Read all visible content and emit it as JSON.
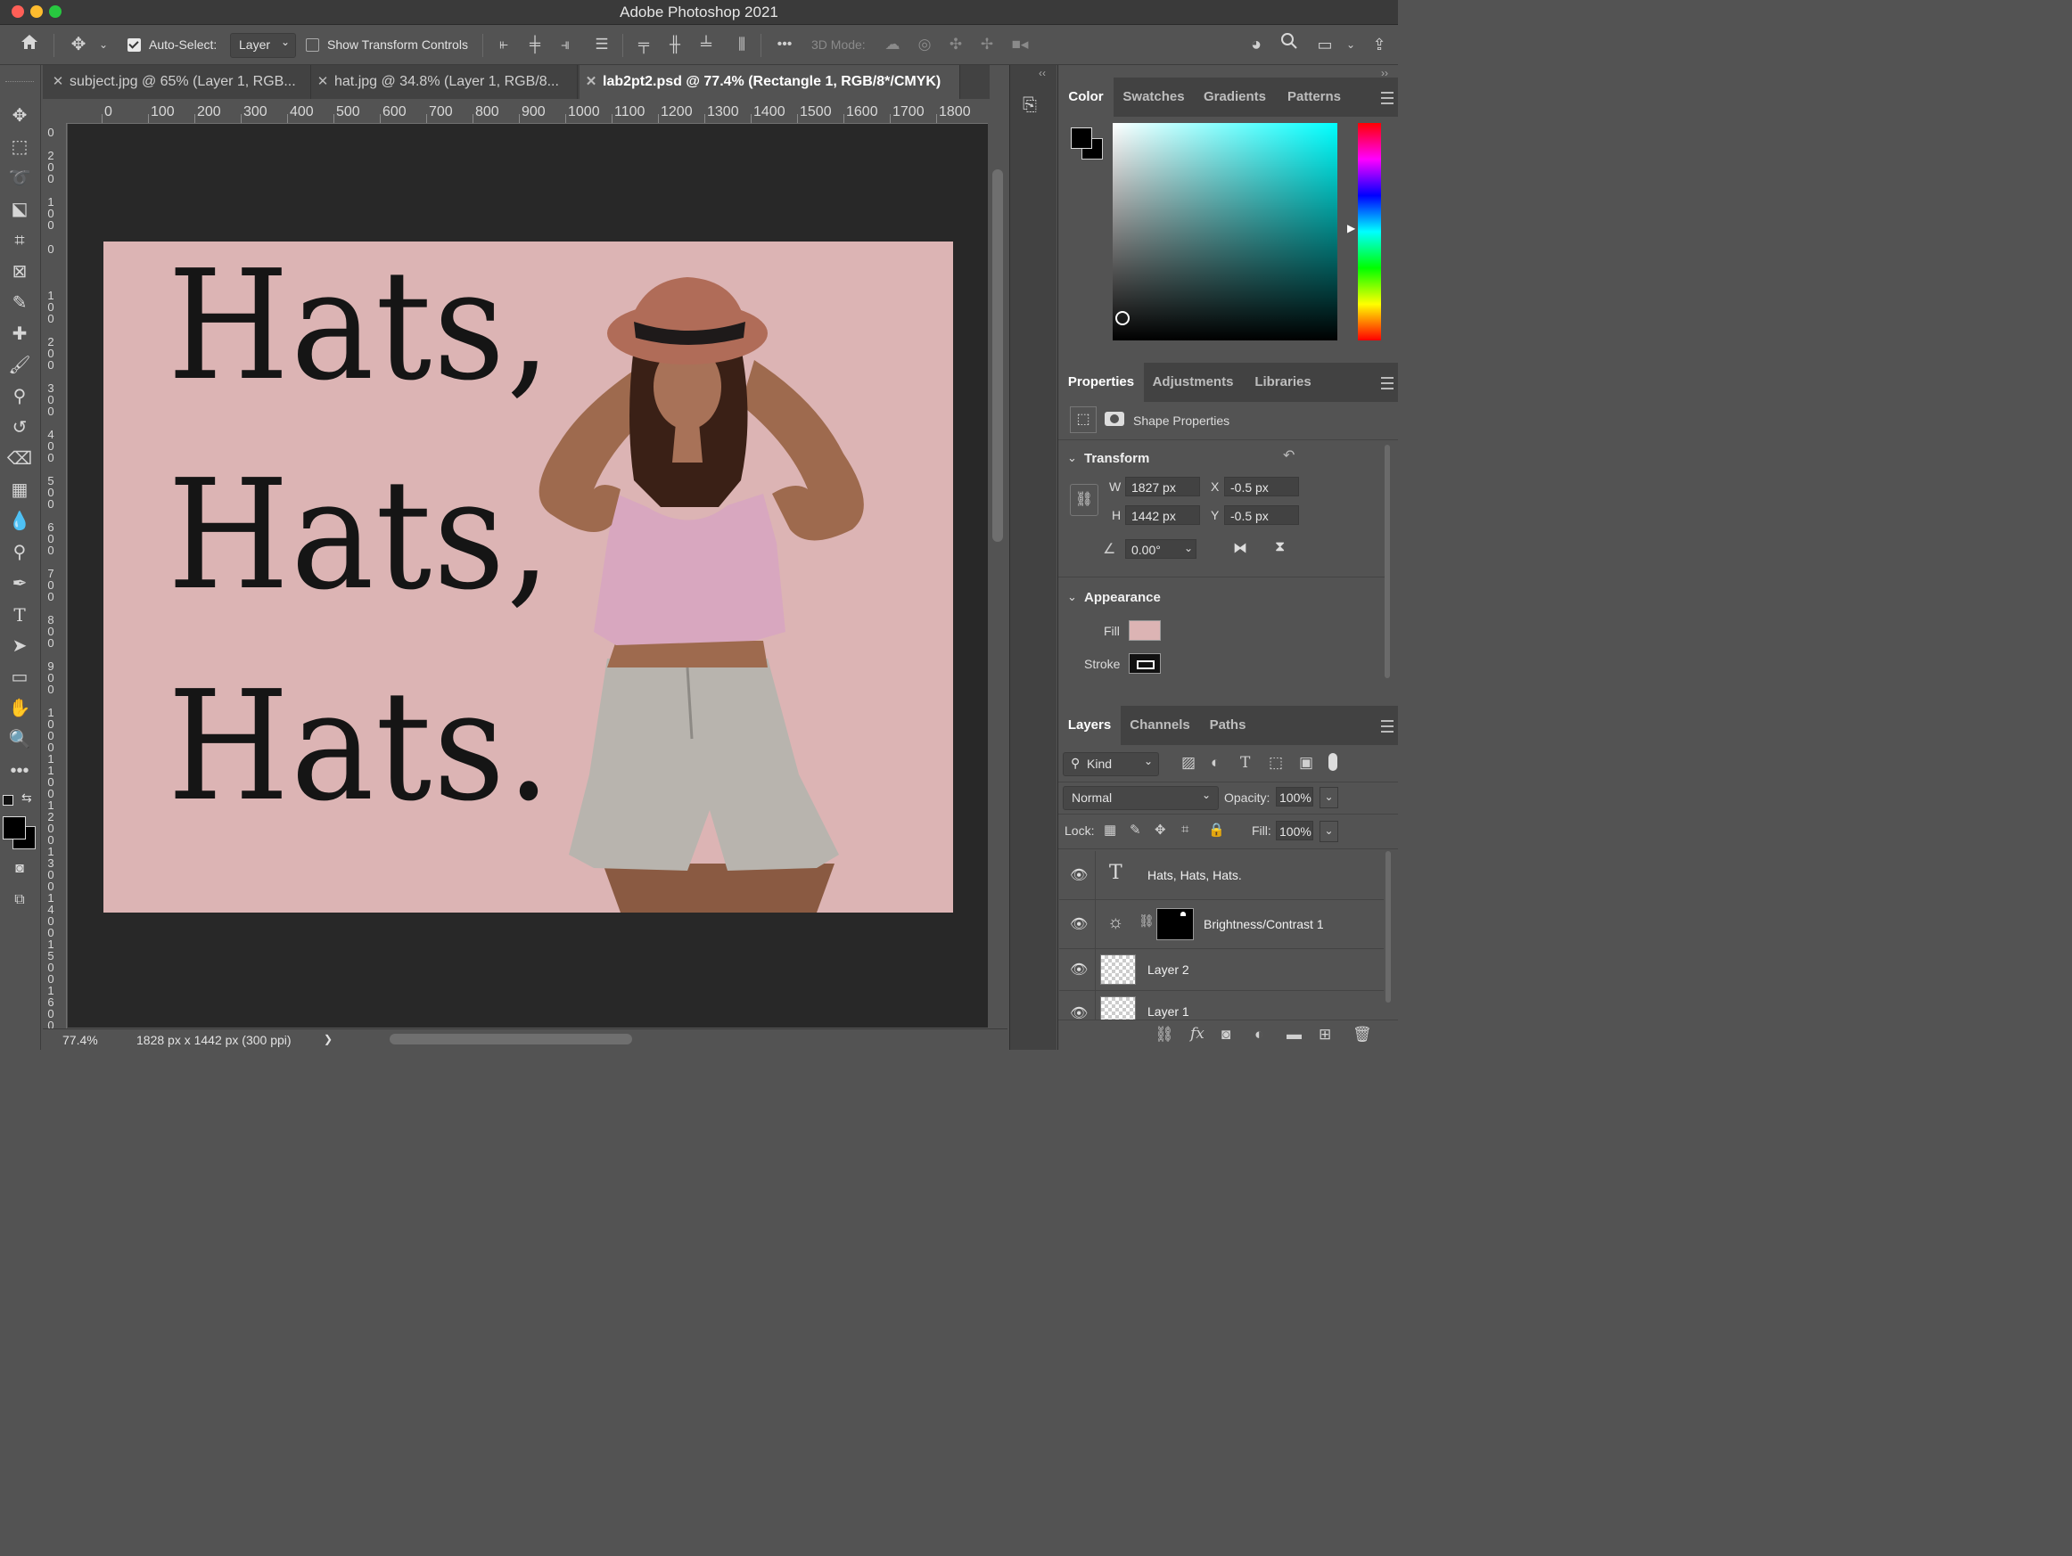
{
  "app": {
    "title": "Adobe Photoshop 2021"
  },
  "options_bar": {
    "auto_select_label": "Auto-Select:",
    "auto_select_value": "Layer",
    "show_transform_label": "Show Transform Controls",
    "three_d_mode_label": "3D Mode:",
    "more_label": "•••"
  },
  "tabs": [
    {
      "label": "subject.jpg @ 65% (Layer 1, RGB..."
    },
    {
      "label": "hat.jpg @ 34.8% (Layer 1, RGB/8..."
    },
    {
      "label": "lab2pt2.psd @ 77.4% (Rectangle 1, RGB/8*/CMYK)"
    }
  ],
  "ruler": {
    "h_labels": [
      "0",
      "100",
      "200",
      "300",
      "400",
      "500",
      "600",
      "700",
      "800",
      "900",
      "1000",
      "1100",
      "1200",
      "1300",
      "1400",
      "1500",
      "1600",
      "1700",
      "1800"
    ],
    "v_labels": [
      "0",
      "2 0 0",
      "1 0 0",
      "0",
      "1 0 0",
      "2 0 0",
      "3 0 0",
      "4 0 0",
      "5 0 0",
      "6 0 0",
      "7 0 0",
      "8 0 0",
      "9 0 0",
      "1 0 0 0",
      "1 1 0 0",
      "1 2 0 0",
      "1 3 0 0",
      "1 4 0 0",
      "1 5 0 0",
      "1 6 0 0"
    ]
  },
  "canvas": {
    "artboard_color": "#dcb4b4",
    "text_lines": [
      "Hats,",
      "Hats,",
      "Hats."
    ]
  },
  "status": {
    "zoom": "77.4%",
    "doc_info": "1828 px x 1442 px (300 ppi)",
    "arrow": "❯"
  },
  "color_panel": {
    "tabs": [
      "Color",
      "Swatches",
      "Gradients",
      "Patterns"
    ],
    "fg_color": "#000000",
    "bg_color": "#000000",
    "hue_color": "#00ffff"
  },
  "properties_panel": {
    "tabs": [
      "Properties",
      "Adjustments",
      "Libraries"
    ],
    "shape_properties_label": "Shape Properties",
    "transform_label": "Transform",
    "w_label": "W",
    "w_value": "1827 px",
    "h_label": "H",
    "h_value": "1442 px",
    "x_label": "X",
    "x_value": "-0.5 px",
    "y_label": "Y",
    "y_value": "-0.5 px",
    "angle_value": "0.00°",
    "appearance_label": "Appearance",
    "fill_label": "Fill",
    "fill_color": "#dcb4b4",
    "stroke_label": "Stroke"
  },
  "layers_panel": {
    "tabs": [
      "Layers",
      "Channels",
      "Paths"
    ],
    "kind_label": "Kind",
    "blend_mode": "Normal",
    "opacity_label": "Opacity:",
    "opacity_value": "100%",
    "lock_label": "Lock:",
    "fill_label": "Fill:",
    "fill_value": "100%",
    "layers": [
      {
        "name": "Hats, Hats, Hats."
      },
      {
        "name": "Brightness/Contrast 1"
      },
      {
        "name": "Layer 2"
      },
      {
        "name": "Layer 1"
      }
    ]
  }
}
